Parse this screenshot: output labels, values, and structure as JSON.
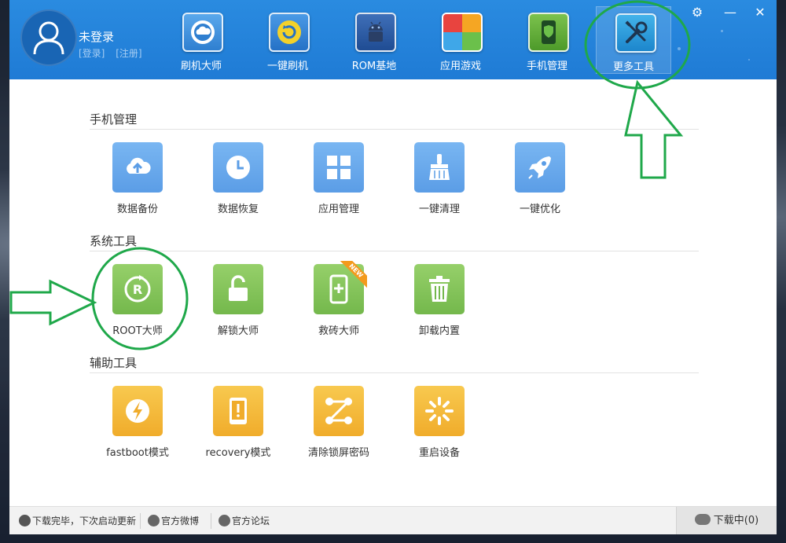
{
  "user": {
    "name": "未登录",
    "login": "[登录]",
    "register": "[注册]"
  },
  "nav": [
    {
      "label": "刷机大师",
      "icon": "cloud-disc-icon"
    },
    {
      "label": "一键刷机",
      "icon": "refresh-icon"
    },
    {
      "label": "ROM基地",
      "icon": "android-icon"
    },
    {
      "label": "应用游戏",
      "icon": "tiles-icon"
    },
    {
      "label": "手机管理",
      "icon": "phone-shield-icon"
    },
    {
      "label": "更多工具",
      "icon": "tools-icon",
      "active": true
    }
  ],
  "sections": {
    "phone_manage": {
      "title": "手机管理",
      "items": [
        {
          "label": "数据备份",
          "icon": "cloud-upload-icon"
        },
        {
          "label": "数据恢复",
          "icon": "clock-icon"
        },
        {
          "label": "应用管理",
          "icon": "grid-icon"
        },
        {
          "label": "一键清理",
          "icon": "broom-icon"
        },
        {
          "label": "一键优化",
          "icon": "rocket-icon"
        }
      ]
    },
    "system_tools": {
      "title": "系统工具",
      "items": [
        {
          "label": "ROOT大师",
          "icon": "root-icon"
        },
        {
          "label": "解锁大师",
          "icon": "unlock-icon"
        },
        {
          "label": "救砖大师",
          "icon": "phone-plus-icon",
          "badge": "NEW"
        },
        {
          "label": "卸载内置",
          "icon": "trash-icon"
        }
      ]
    },
    "aux_tools": {
      "title": "辅助工具",
      "items": [
        {
          "label": "fastboot模式",
          "icon": "lightning-icon"
        },
        {
          "label": "recovery模式",
          "icon": "phone-alert-icon"
        },
        {
          "label": "清除锁屏密码",
          "icon": "pattern-icon"
        },
        {
          "label": "重启设备",
          "icon": "spinner-icon"
        }
      ]
    }
  },
  "footer": {
    "status": "下载完毕，下次启动更新",
    "weibo": "官方微博",
    "forum": "官方论坛",
    "downloading": "下载中(0)"
  },
  "colors": {
    "header": "#1f7bd5",
    "tile_blue": "#5b9de6",
    "tile_green": "#74b84c",
    "tile_yellow": "#f0ac2b",
    "annotation": "#1fa84a"
  }
}
